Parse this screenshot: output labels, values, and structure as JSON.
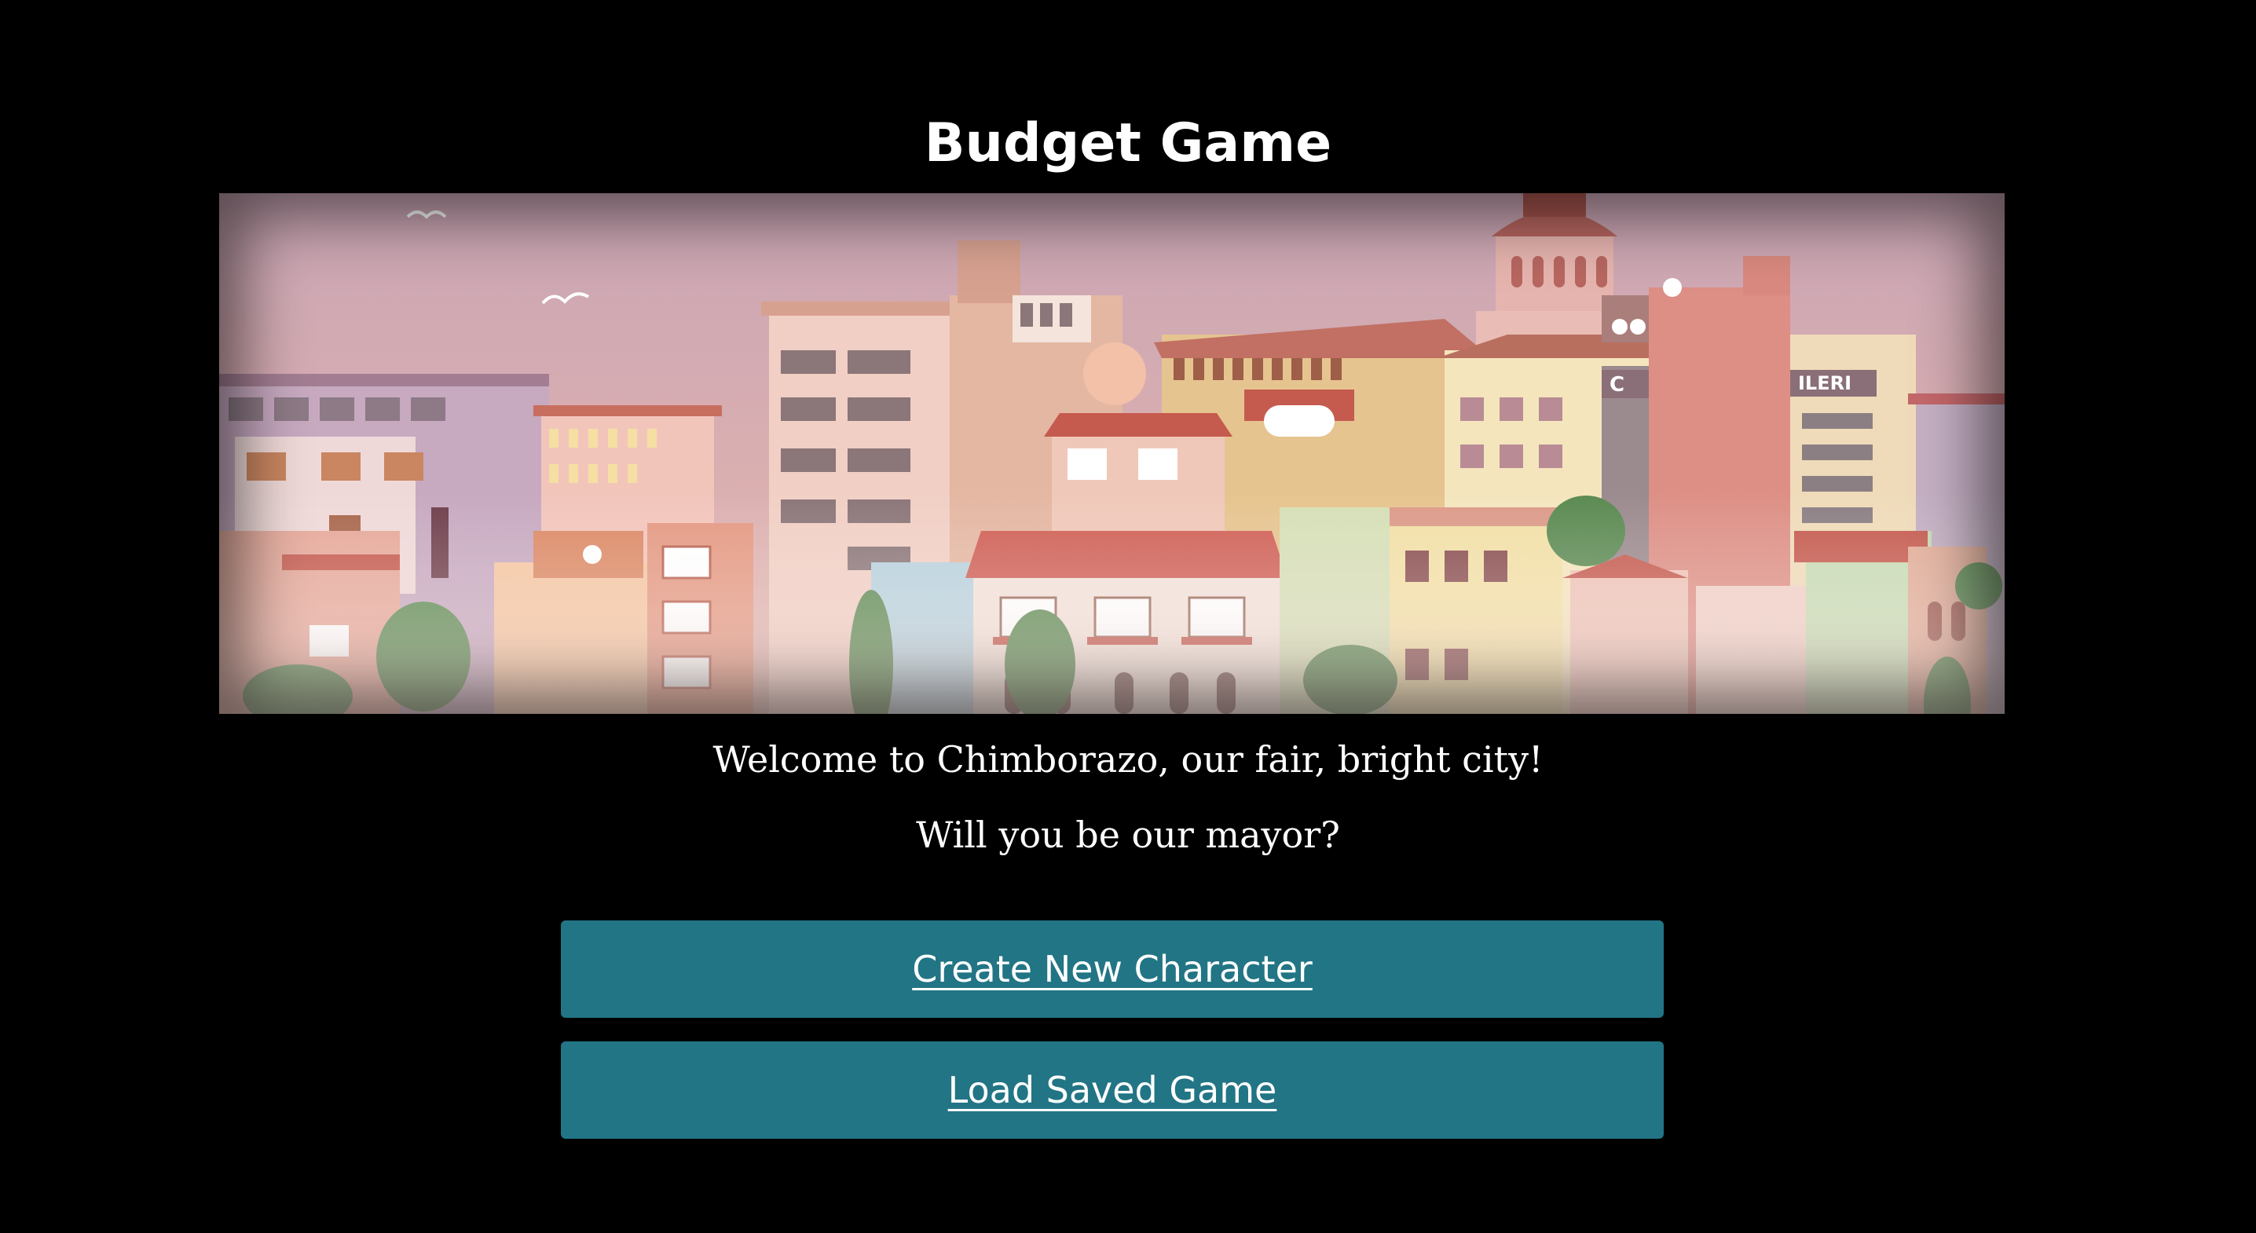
{
  "game": {
    "title": "Budget Game"
  },
  "intro": {
    "welcome_line": "Welcome to Chimborazo, our fair, bright city!",
    "question_line": "Will you be our mayor?"
  },
  "menu": {
    "create_label": "Create New Character",
    "load_label": "Load Saved Game"
  },
  "banner": {
    "image": "city-skyline-illustration",
    "sign_left": "C",
    "sign_right": "ILERI"
  },
  "colors": {
    "background": "#000000",
    "button": "#227585",
    "text": "#ffffff",
    "sky_top": "#c9a5b4",
    "sky_bottom": "#e3b7ae"
  }
}
